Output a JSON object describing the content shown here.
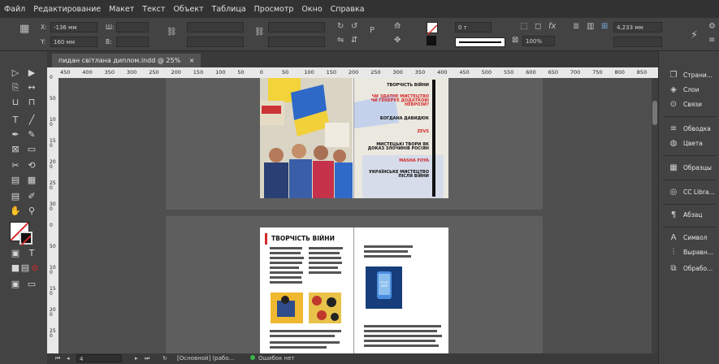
{
  "menu": [
    "Файл",
    "Редактирование",
    "Макет",
    "Текст",
    "Объект",
    "Таблица",
    "Просмотр",
    "Окно",
    "Справка"
  ],
  "control": {
    "x_label": "X:",
    "x_value": "-136 мм",
    "y_label": "Y:",
    "y_value": "160 мм",
    "w_label": "Ш:",
    "h_label": "В:",
    "stroke_value": "0 т",
    "zoom_value": "100%",
    "size_value": "4,233 мм"
  },
  "tab": {
    "label": "пидан світлана диплом.indd @ 25%",
    "close": "×"
  },
  "ruler_h": [
    "450",
    "400",
    "350",
    "300",
    "250",
    "200",
    "150",
    "100",
    "50",
    "0",
    "50",
    "100",
    "150",
    "200",
    "250",
    "300",
    "350",
    "400",
    "450",
    "500",
    "550",
    "600",
    "650",
    "700",
    "750",
    "800",
    "850"
  ],
  "ruler_v": [
    "0",
    "50",
    "100",
    "150",
    "200",
    "250",
    "300",
    "0",
    "50",
    "100",
    "150",
    "200",
    "250"
  ],
  "spread1": {
    "headlines": [
      {
        "text": "ТВОРЧІСТЬ ВІЙНИ",
        "red": false
      },
      {
        "text": "ЧИ ЗДАТНЕ МИСТЕЦТВО ЧИ ГЕНЕРУЄ ДОДАТКОВІ НЕВРОЗИ?",
        "red": true
      },
      {
        "text": "БОГДАНА ДАВИДЮК",
        "red": false
      },
      {
        "text": "ZEVS",
        "red": true
      },
      {
        "text": "МИСТЕЦЬКІ ТВОРИ ЯК ДОКАЗ ЗЛОЧИНІВ РОСІЯН",
        "red": false
      },
      {
        "text": "MASHA FOYA",
        "red": true
      },
      {
        "text": "УКРАЇНСЬКЕ МИСТЕЦТВО ПІСЛЯ ВІЙНИ",
        "red": false
      }
    ]
  },
  "spread2": {
    "title": "ТВОРЧІСТЬ ВІЙНИ",
    "phone_text": "STOP WAR"
  },
  "status": {
    "page": "4",
    "master": "[Основной] (рабо...",
    "errors": "Ошибок нет"
  },
  "panels": [
    {
      "label": "Страни...",
      "icon": "pages-icon"
    },
    {
      "label": "Слои",
      "icon": "layers-icon"
    },
    {
      "label": "Связи",
      "icon": "links-icon"
    },
    {
      "label": "Обводка",
      "icon": "stroke-icon"
    },
    {
      "label": "Цвета",
      "icon": "color-icon"
    },
    {
      "label": "Образцы",
      "icon": "swatches-icon"
    },
    {
      "label": "CC Libra...",
      "icon": "cc-libraries-icon"
    },
    {
      "label": "Абзац",
      "icon": "paragraph-icon"
    },
    {
      "label": "Символ",
      "icon": "character-icon"
    },
    {
      "label": "Выравн...",
      "icon": "align-icon"
    },
    {
      "label": "Обрабо...",
      "icon": "pathfinder-icon"
    }
  ],
  "colors": {
    "accent_red": "#d42a2a",
    "panel_bg": "#434343",
    "menubar_bg": "#323232",
    "pasteboard": "#5e5e5e"
  }
}
